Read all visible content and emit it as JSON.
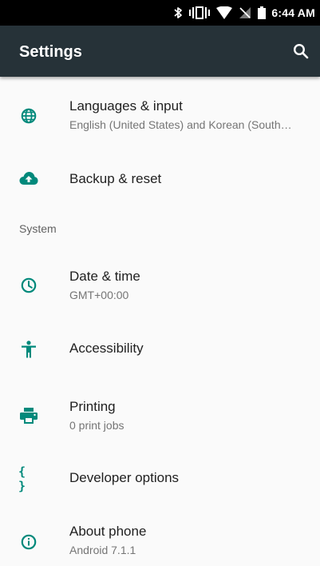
{
  "status_bar": {
    "time": "6:44 AM",
    "icons": [
      "bluetooth-icon",
      "vibrate-icon",
      "wifi-icon",
      "no-sim-icon",
      "battery-icon"
    ]
  },
  "toolbar": {
    "title": "Settings",
    "search_icon": "search-icon"
  },
  "colors": {
    "toolbar_bg": "#263238",
    "accent": "#00897b",
    "primary_text": "#212121",
    "secondary_text": "#757575",
    "background": "#fafafa"
  },
  "items": [
    {
      "icon": "globe-icon",
      "title": "Languages & input",
      "subtitle": "English (United States) and Korean (South…"
    },
    {
      "icon": "cloud-upload-icon",
      "title": "Backup & reset",
      "subtitle": ""
    },
    {
      "icon": "clock-icon",
      "title": "Date & time",
      "subtitle": "GMT+00:00"
    },
    {
      "icon": "accessibility-icon",
      "title": "Accessibility",
      "subtitle": ""
    },
    {
      "icon": "printer-icon",
      "title": "Printing",
      "subtitle": "0 print jobs"
    },
    {
      "icon": "braces-icon",
      "icon_text": "{ }",
      "title": "Developer options",
      "subtitle": ""
    },
    {
      "icon": "info-icon",
      "title": "About phone",
      "subtitle": "Android 7.1.1"
    }
  ],
  "sections": {
    "system": "System"
  }
}
